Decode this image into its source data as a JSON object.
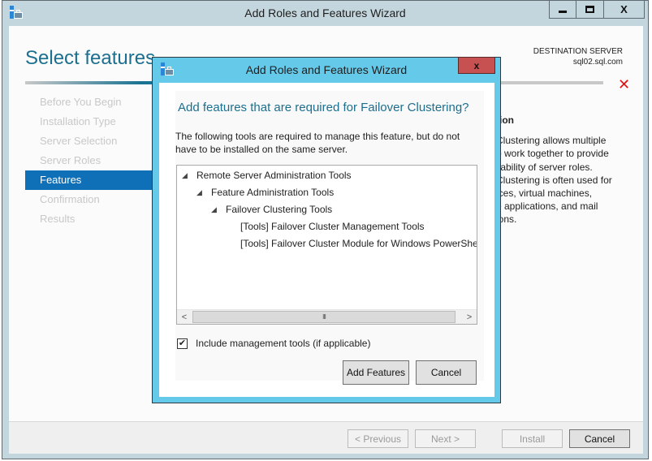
{
  "window": {
    "title": "Add Roles and Features Wizard",
    "controls": {
      "minimize": "minimize",
      "maximize": "maximize",
      "close": "X"
    }
  },
  "page": {
    "title": "Select features",
    "destination_label": "DESTINATION SERVER",
    "destination_server": "sql02.sql.com",
    "abort_icon": "✕"
  },
  "nav": {
    "items": [
      {
        "label": "Before You Begin",
        "active": false
      },
      {
        "label": "Installation Type",
        "active": false
      },
      {
        "label": "Server Selection",
        "active": false
      },
      {
        "label": "Server Roles",
        "active": false
      },
      {
        "label": "Features",
        "active": true
      },
      {
        "label": "Confirmation",
        "active": false
      },
      {
        "label": "Results",
        "active": false
      }
    ]
  },
  "description": {
    "header": "tion",
    "lines": [
      "Clustering allows multiple",
      "o work together to provide",
      "ilability of server roles.",
      "Clustering is often used for",
      "ices, virtual machines,",
      "e applications, and mail",
      "ions."
    ]
  },
  "footer": {
    "previous": "< Previous",
    "next": "Next >",
    "install": "Install",
    "cancel": "Cancel"
  },
  "modal": {
    "title": "Add Roles and Features Wizard",
    "close": "x",
    "heading": "Add features that are required for Failover Clustering?",
    "text": "The following tools are required to manage this feature, but do not have to be installed on the same server.",
    "tree": [
      {
        "label": "Remote Server Administration Tools",
        "level": 0,
        "expanded": true
      },
      {
        "label": "Feature Administration Tools",
        "level": 1,
        "expanded": true
      },
      {
        "label": "Failover Clustering Tools",
        "level": 2,
        "expanded": true
      },
      {
        "label": "[Tools] Failover Cluster Management Tools",
        "level": 3,
        "expanded": null
      },
      {
        "label": "[Tools] Failover Cluster Module for Windows PowerShell",
        "level": 3,
        "expanded": null
      }
    ],
    "scroll": {
      "left": "<",
      "right": ">",
      "thumb": "III"
    },
    "include_tools_label": "Include management tools (if applicable)",
    "include_tools_checked": true,
    "add_features": "Add Features",
    "cancel": "Cancel"
  }
}
